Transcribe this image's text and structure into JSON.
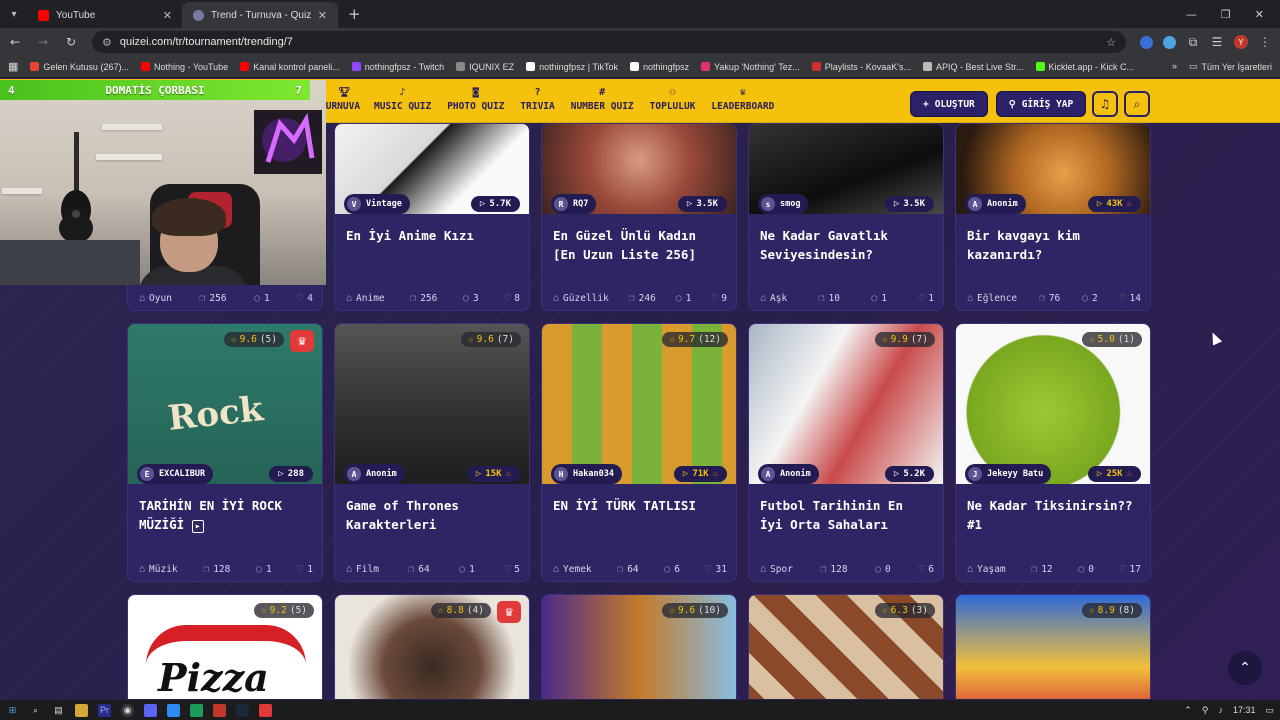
{
  "browser": {
    "tabs": [
      {
        "title": "YouTube",
        "color": "#ff0000",
        "active": false
      },
      {
        "title": "Trend - Turnuva - Quizei",
        "color": "#7a7aa0",
        "active": true
      }
    ],
    "url": "quizei.com/tr/tournament/trending/7",
    "profile_initial": "Y",
    "bookmarks": [
      {
        "label": "Gelen Kutusu (267)...",
        "color": "#ea4335"
      },
      {
        "label": "Nothing - YouTube",
        "color": "#ff0000"
      },
      {
        "label": "Kanal kontrol paneli...",
        "color": "#ff0000"
      },
      {
        "label": "nothingfpsz - Twitch",
        "color": "#9146ff"
      },
      {
        "label": "IQUNIX EZ",
        "color": "#888888"
      },
      {
        "label": "nothingfpsz | TikTok",
        "color": "#ffffff"
      },
      {
        "label": "nothingfpsz",
        "color": "#ffffff"
      },
      {
        "label": "Yakup 'Nothing' Tez...",
        "color": "#e1306c"
      },
      {
        "label": "Playlists - KovaaK's...",
        "color": "#d32f2f"
      },
      {
        "label": "APIQ - Best Live Str...",
        "color": "#bbbbbb"
      },
      {
        "label": "Kicklet.app - Kick C...",
        "color": "#53fc18"
      }
    ],
    "bookmarks_more": "»",
    "bookmarks_all": "Tüm Yer İşaretleri"
  },
  "webcam": {
    "banner_left": "4",
    "banner_label": "DOMATİS ÇORBASI",
    "banner_right": "7"
  },
  "nav": {
    "links": [
      {
        "label": "TURNUVA",
        "icon": "trophy-icon"
      },
      {
        "label": "MUSIC QUIZ",
        "icon": "music-icon"
      },
      {
        "label": "PHOTO QUIZ",
        "icon": "camera-icon"
      },
      {
        "label": "TRIVIA",
        "icon": "question-icon"
      },
      {
        "label": "NUMBER QUIZ",
        "icon": "hash-icon"
      },
      {
        "label": "TOPLULUK",
        "icon": "users-icon"
      },
      {
        "label": "LEADERBOARD",
        "icon": "trophy-icon"
      }
    ],
    "create_label": "OLUŞTUR",
    "login_label": "GİRİŞ YAP"
  },
  "cards": [
    {
      "author": "Vintage",
      "author_initial": "V",
      "plays": "5.7K",
      "hot": false,
      "title": "En İyi Anime Kızı",
      "category": "Anime",
      "items": "256",
      "comments": "3",
      "likes": "8"
    },
    {
      "author": "RQ7",
      "author_initial": "R",
      "plays": "3.5K",
      "hot": false,
      "title": "En Güzel Ünlü Kadın [En Uzun Liste 256]",
      "category": "Güzellik",
      "items": "246",
      "comments": "1",
      "likes": "9"
    },
    {
      "author": "smog",
      "author_initial": "s",
      "plays": "3.5K",
      "hot": false,
      "title": "Ne Kadar Gavatlık Seviyesindesin?",
      "category": "Aşk",
      "items": "10",
      "comments": "1",
      "likes": "1"
    },
    {
      "author": "Anonim",
      "author_initial": "A",
      "plays": "43K",
      "hot": true,
      "title": "Bir kavgayı kim kazanırdı?",
      "category": "Eğlence",
      "items": "76",
      "comments": "2",
      "likes": "14"
    },
    {
      "author": "EXCALIBUR",
      "author_initial": "E",
      "plays": "288",
      "hot": false,
      "rating": "9.6",
      "rating_count": "(5)",
      "crown": true,
      "title": "TARİHİN EN İYİ ROCK MÜZİĞİ",
      "category": "Müzik",
      "items": "128",
      "comments": "1",
      "likes": "1"
    },
    {
      "author": "Anonim",
      "author_initial": "A",
      "plays": "15K",
      "hot": true,
      "rating": "9.6",
      "rating_count": "(7)",
      "title": "Game of Thrones Karakterleri",
      "category": "Film",
      "items": "64",
      "comments": "1",
      "likes": "5"
    },
    {
      "author": "Hakan034",
      "author_initial": "H",
      "plays": "71K",
      "hot": true,
      "rating": "9.7",
      "rating_count": "(12)",
      "title": "EN İYİ TÜRK TATLISI",
      "category": "Yemek",
      "items": "64",
      "comments": "6",
      "likes": "31"
    },
    {
      "author": "Anonim",
      "author_initial": "A",
      "plays": "5.2K",
      "hot": false,
      "rating": "9.9",
      "rating_count": "(7)",
      "title": "Futbol Tarihinin En İyi Orta Sahaları",
      "category": "Spor",
      "items": "128",
      "comments": "0",
      "likes": "6"
    },
    {
      "author": "Jekeyy Batu",
      "author_initial": "J",
      "plays": "25K",
      "hot": true,
      "rating": "5.0",
      "rating_count": "(1)",
      "title": "Ne Kadar Tiksinirsin?? #1",
      "category": "Yaşam",
      "items": "12",
      "comments": "0",
      "likes": "17"
    },
    {
      "rating": "9.2",
      "rating_count": "(5)"
    },
    {
      "rating": "8.8",
      "rating_count": "(4)",
      "crown": true
    },
    {
      "rating": "9.6",
      "rating_count": "(10)"
    },
    {
      "rating": "6.3",
      "rating_count": "(3)"
    },
    {
      "rating": "8.9",
      "rating_count": "(8)"
    }
  ],
  "row1_first_stats": {
    "category": "Oyun",
    "items": "256",
    "comments": "1",
    "likes": "4"
  },
  "taskbar": {
    "time": "17:31"
  }
}
